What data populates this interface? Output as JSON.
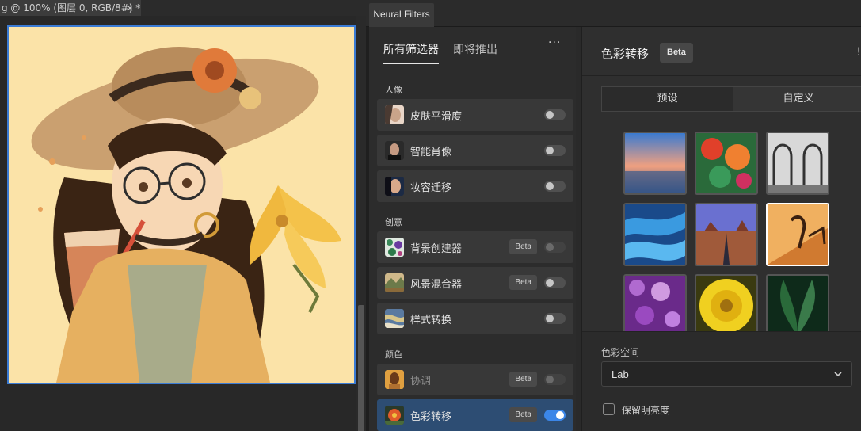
{
  "document": {
    "tab_title": "g @ 100% (图层 0, RGB/8#) *",
    "close_glyph": "×"
  },
  "neural_filters": {
    "window_tab": "Neural Filters",
    "list_tabs": {
      "all": "所有筛选器",
      "coming": "即将推出"
    },
    "more_glyph": "···",
    "sections": [
      {
        "label": "人像",
        "items": [
          {
            "name": "皮肤平滑度",
            "beta": "",
            "state": "off"
          },
          {
            "name": "智能肖像",
            "beta": "",
            "state": "off"
          },
          {
            "name": "妆容迁移",
            "beta": "",
            "state": "off"
          }
        ]
      },
      {
        "label": "创意",
        "items": [
          {
            "name": "背景创建器",
            "beta": "Beta",
            "state": "disabled"
          },
          {
            "name": "风景混合器",
            "beta": "Beta",
            "state": "off"
          },
          {
            "name": "样式转换",
            "beta": "",
            "state": "off"
          }
        ]
      },
      {
        "label": "颜色",
        "items": [
          {
            "name": "协调",
            "beta": "Beta",
            "state": "disabled"
          },
          {
            "name": "色彩转移",
            "beta": "Beta",
            "state": "on"
          }
        ]
      }
    ]
  },
  "detail": {
    "title": "色彩转移",
    "beta": "Beta",
    "edge_glyph": "!",
    "segments": {
      "preset": "预设",
      "custom": "自定义"
    },
    "presets": [
      "sunset-lake",
      "colorful-abstract",
      "bw-arches",
      "blue-feathers",
      "desert-road",
      "orange-sunset-art",
      "purple-flowers",
      "yellow-flower",
      "green-leaves"
    ],
    "selected_preset": 5,
    "color_space_label": "色彩空间",
    "color_space_value": "Lab",
    "preserve_luminance": "保留明亮度"
  }
}
